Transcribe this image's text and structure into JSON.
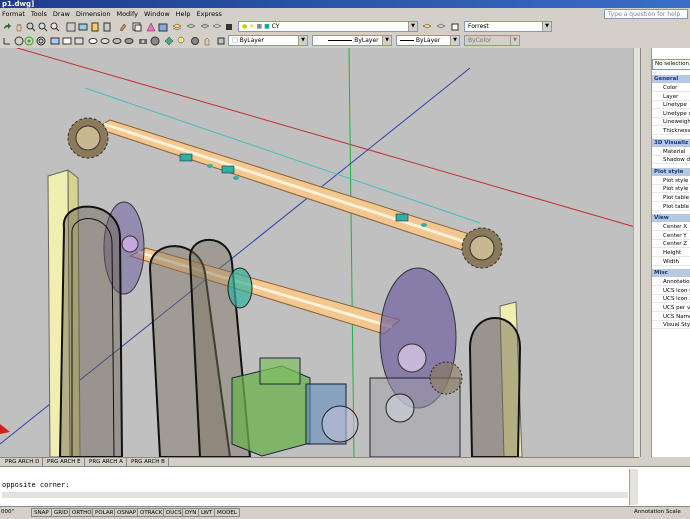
{
  "window": {
    "title": "p1.dwg]"
  },
  "menu": [
    "Format",
    "Tools",
    "Draw",
    "Dimension",
    "Modify",
    "Window",
    "Help",
    "Express"
  ],
  "help_search": {
    "placeholder": "Type a question for help"
  },
  "toolbar": {
    "layer_value": "CY",
    "visual_style_value": "Forrest"
  },
  "properties_toolbar": {
    "color": "ByLayer",
    "linetype": "ByLayer",
    "lineweight": "ByLayer",
    "plotstyle": "ByColor"
  },
  "properties_palette": {
    "selection": "No selection",
    "sections": [
      {
        "title": "General",
        "rows": [
          "Color",
          "Layer",
          "Linetype",
          "Linetype sc",
          "Lineweight",
          "Thickness"
        ]
      },
      {
        "title": "3D Visualiz",
        "rows": [
          "Material",
          "Shadow disp"
        ]
      },
      {
        "title": "Plot style",
        "rows": [
          "Plot style",
          "Plot style ta",
          "Plot table a",
          "Plot table ty"
        ]
      },
      {
        "title": "View",
        "rows": [
          "Center X",
          "Center Y",
          "Center Z",
          "Height",
          "Width"
        ]
      },
      {
        "title": "Misc",
        "rows": [
          "Annotation",
          "UCS icon O",
          "UCS icon a",
          "UCS per vi",
          "UCS Name",
          "Visual Style"
        ]
      }
    ]
  },
  "layout_tabs": [
    "PRG ARCH D",
    "PRG ARCH E",
    "PRG ARCH A",
    "PRG ARCH B"
  ],
  "command": {
    "line1": "opposite corner:"
  },
  "status": {
    "coords": "000\"",
    "buttons": [
      "SNAP",
      "GRID",
      "ORTHO",
      "POLAR",
      "OSNAP",
      "OTRACK",
      "DUCS",
      "DYN",
      "LWT",
      "MODEL"
    ],
    "annotation_scale": "Annotation Scale"
  },
  "colors": {
    "viewport_bg": "#c0c0c0",
    "shaft": "#f2c890",
    "sprocket": "#8a7a5a",
    "frame": "#f0eeb0",
    "disc": "#7060a0",
    "motor": "#6ab04c",
    "axis_red": "#c03030",
    "axis_green": "#20b040",
    "axis_blue": "#3040b0"
  }
}
